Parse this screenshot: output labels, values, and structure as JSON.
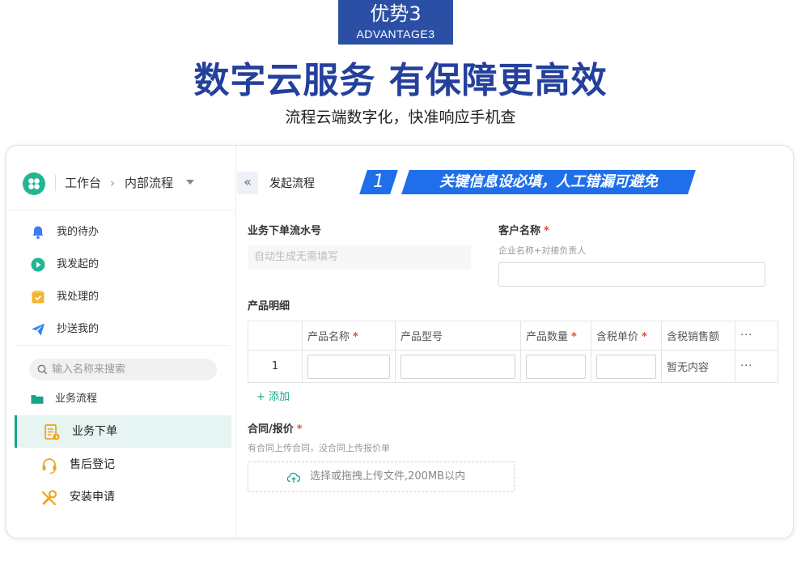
{
  "header": {
    "badge_title": "优势3",
    "badge_subtitle": "ADVANTAGE3",
    "headline": "数字云服务 有保障更高效",
    "subline": "流程云端数字化，快准响应手机查"
  },
  "sidebar": {
    "breadcrumb": [
      "工作台",
      "内部流程"
    ],
    "breadcrumb_separator": "›",
    "menu": [
      {
        "label": "我的待办",
        "icon": "bell-icon",
        "color": "#3d7bf2"
      },
      {
        "label": "我发起的",
        "icon": "play-circle-icon",
        "color": "#22b594"
      },
      {
        "label": "我处理的",
        "icon": "inbox-icon",
        "color": "#f4b32a"
      },
      {
        "label": "抄送我的",
        "icon": "paper-plane-icon",
        "color": "#2f86ea"
      }
    ],
    "search_placeholder": "输入名称来搜索",
    "folder_label": "业务流程",
    "processes": [
      {
        "label": "业务下单",
        "icon": "order-document-icon",
        "active": true
      },
      {
        "label": "售后登记",
        "icon": "headset-icon",
        "active": false
      },
      {
        "label": "安装申请",
        "icon": "wrench-icon",
        "active": false
      }
    ]
  },
  "main": {
    "collapse_icon": "«",
    "page_title": "发起流程",
    "tip_number": "1",
    "tip_text": "关键信息设必填，人工错漏可避免",
    "accent_color": "#1f6fea",
    "fields": {
      "serial_label": "业务下单流水号",
      "serial_placeholder": "自动生成无需填写",
      "customer_label": "客户名称",
      "customer_required": "*",
      "customer_hint": "企业名称+对接负责人"
    },
    "product_section_label": "产品明细",
    "table": {
      "columns": [
        {
          "label": "",
          "required": false
        },
        {
          "label": "产品名称",
          "required": true
        },
        {
          "label": "产品型号",
          "required": false
        },
        {
          "label": "产品数量",
          "required": true
        },
        {
          "label": "含税单价",
          "required": true
        },
        {
          "label": "含税销售额",
          "required": false
        },
        {
          "label": "···",
          "required": false
        }
      ],
      "rows": [
        {
          "index": "1",
          "amount": "暂无内容",
          "more": "···"
        }
      ],
      "required_mark": "*"
    },
    "add_label": "+ 添加",
    "contract": {
      "label": "合同/报价",
      "required": "*",
      "hint": "有合同上传合同，没合同上传报价单",
      "upload_text": "选择或拖拽上传文件,200MB以内"
    }
  }
}
